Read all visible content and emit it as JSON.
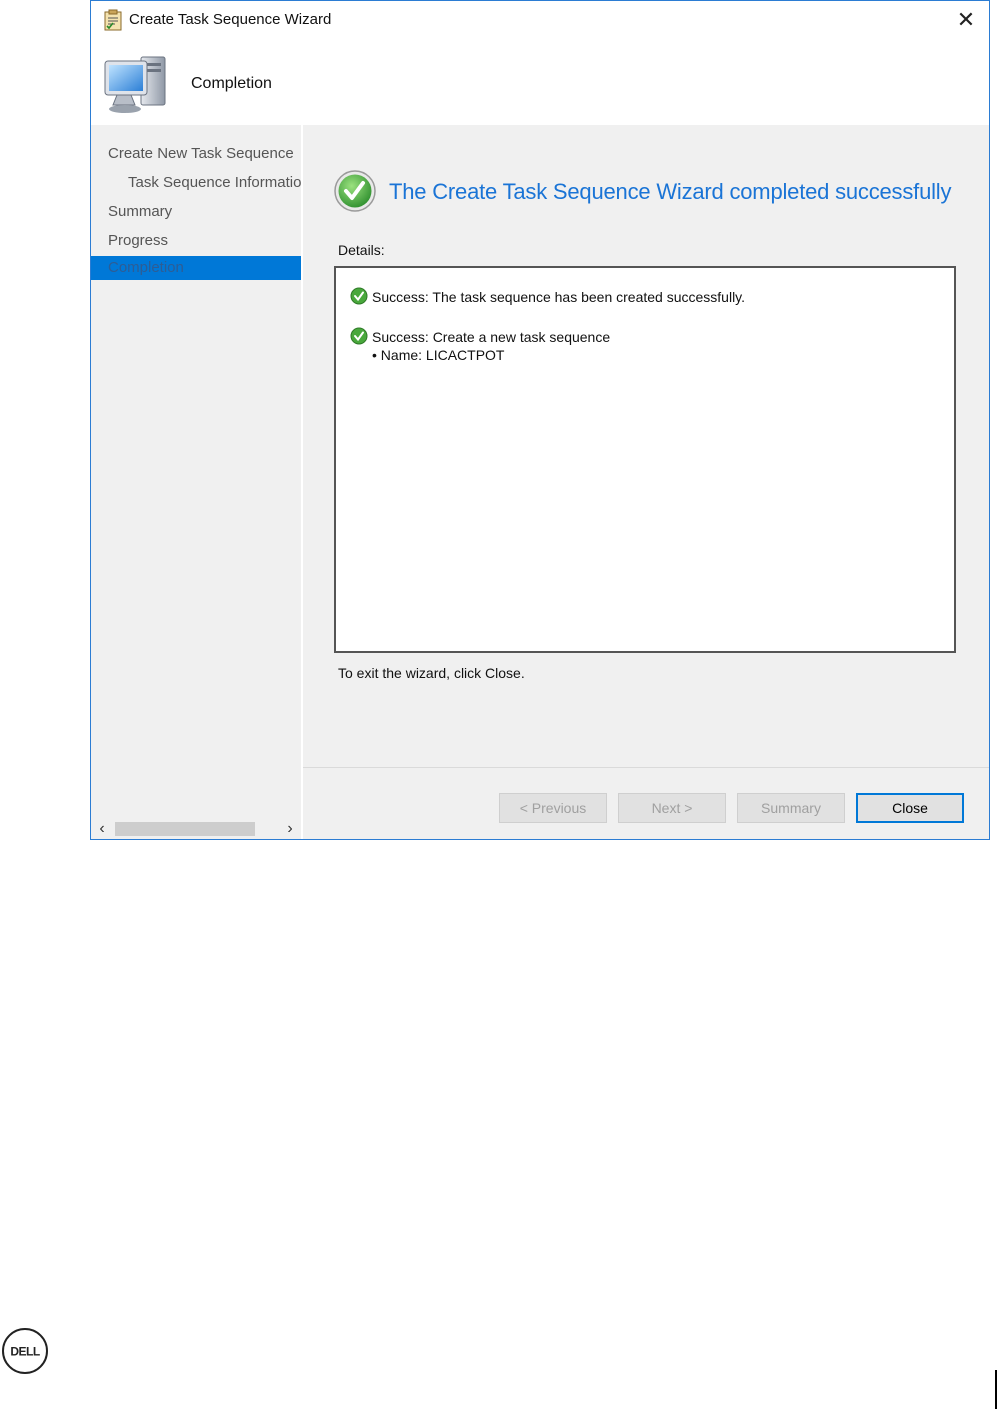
{
  "window": {
    "title": "Create Task Sequence Wizard",
    "close_glyph": "✕",
    "header_title": "Completion"
  },
  "nav": {
    "items": [
      {
        "label": "Create New Task Sequence",
        "indent": 0,
        "selected": false
      },
      {
        "label": "Task Sequence Informatio",
        "indent": 1,
        "selected": false
      },
      {
        "label": "Summary",
        "indent": 0,
        "selected": false
      },
      {
        "label": "Progress",
        "indent": 0,
        "selected": false
      },
      {
        "label": "Completion",
        "indent": 0,
        "selected": true
      }
    ],
    "scroll_left": "‹",
    "scroll_right": "›"
  },
  "content": {
    "heading": "The Create Task Sequence Wizard completed successfully",
    "details_label": "Details:",
    "details": [
      {
        "text": "Success: The task sequence has been created successfully.",
        "sub": []
      },
      {
        "text": "Success: Create a new task sequence",
        "sub": [
          "•  Name: LICACTPOT"
        ]
      }
    ],
    "exit_text": "To exit the wizard, click Close."
  },
  "buttons": {
    "previous": "< Previous",
    "next": "Next >",
    "summary": "Summary",
    "close": "Close"
  },
  "icons": {
    "app": "clipboard-icon",
    "header": "computer-icon",
    "success": "green-check-icon",
    "brand": "dell-logo"
  },
  "colors": {
    "accent": "#0078d7",
    "heading": "#1a74d6",
    "success_green": "#3aa23a"
  }
}
